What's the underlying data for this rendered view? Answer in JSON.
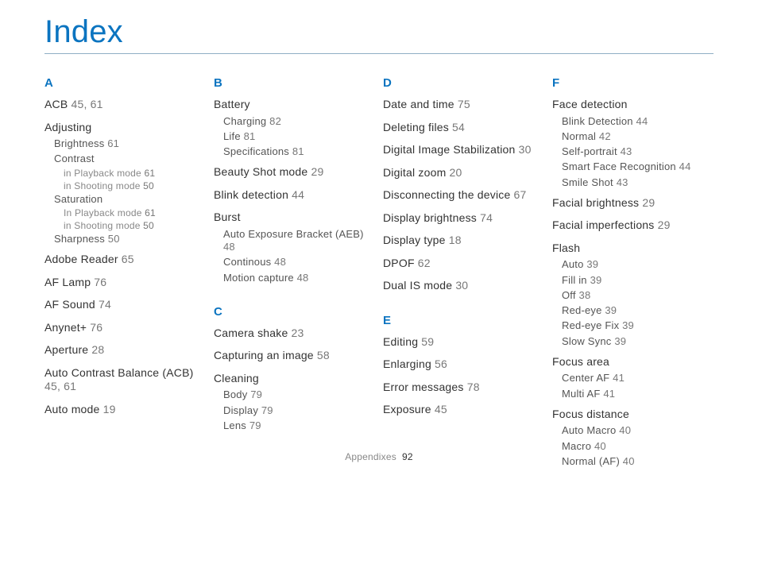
{
  "title": "Index",
  "footer": {
    "section": "Appendixes",
    "page": "92"
  },
  "columns": [
    [
      {
        "letter": "A",
        "items": [
          {
            "t": "ACB",
            "p": "45, 61"
          },
          {
            "t": "Adjusting",
            "children": [
              {
                "t": "Brightness",
                "p": "61"
              },
              {
                "t": "Contrast",
                "children": [
                  {
                    "t": "in Playback mode",
                    "p": "61"
                  },
                  {
                    "t": "in Shooting mode",
                    "p": "50"
                  }
                ]
              },
              {
                "t": "Saturation",
                "children": [
                  {
                    "t": "In Playback mode",
                    "p": "61"
                  },
                  {
                    "t": "in Shooting mode",
                    "p": "50"
                  }
                ]
              },
              {
                "t": "Sharpness",
                "p": "50"
              }
            ]
          },
          {
            "t": "Adobe Reader",
            "p": "65"
          },
          {
            "t": "AF Lamp",
            "p": "76"
          },
          {
            "t": "AF Sound",
            "p": "74"
          },
          {
            "t": "Anynet+",
            "p": "76"
          },
          {
            "t": "Aperture",
            "p": "28"
          },
          {
            "t": "Auto Contrast Balance (ACB)",
            "p": "45, 61"
          },
          {
            "t": "Auto mode",
            "p": "19"
          }
        ]
      }
    ],
    [
      {
        "letter": "B",
        "items": [
          {
            "t": "Battery",
            "children": [
              {
                "t": "Charging",
                "p": "82"
              },
              {
                "t": "Life",
                "p": "81"
              },
              {
                "t": "Specifications",
                "p": "81"
              }
            ]
          },
          {
            "t": "Beauty Shot mode",
            "p": "29"
          },
          {
            "t": "Blink detection",
            "p": "44"
          },
          {
            "t": "Burst",
            "children": [
              {
                "t": "Auto Exposure Bracket (AEB)",
                "p": "48"
              },
              {
                "t": "Continous",
                "p": "48"
              },
              {
                "t": "Motion capture",
                "p": "48"
              }
            ]
          }
        ]
      },
      {
        "letter": "C",
        "items": [
          {
            "t": "Camera shake",
            "p": "23"
          },
          {
            "t": "Capturing an image",
            "p": "58"
          },
          {
            "t": "Cleaning",
            "children": [
              {
                "t": "Body",
                "p": "79"
              },
              {
                "t": "Display",
                "p": "79"
              },
              {
                "t": "Lens",
                "p": "79"
              }
            ]
          }
        ]
      }
    ],
    [
      {
        "letter": "D",
        "items": [
          {
            "t": "Date and time",
            "p": "75"
          },
          {
            "t": "Deleting files",
            "p": "54"
          },
          {
            "t": "Digital Image Stabilization",
            "p": "30"
          },
          {
            "t": "Digital zoom",
            "p": "20"
          },
          {
            "t": "Disconnecting the device",
            "p": "67"
          },
          {
            "t": "Display brightness",
            "p": "74"
          },
          {
            "t": "Display type",
            "p": "18"
          },
          {
            "t": "DPOF",
            "p": "62"
          },
          {
            "t": "Dual IS mode",
            "p": "30"
          }
        ]
      },
      {
        "letter": "E",
        "items": [
          {
            "t": "Editing",
            "p": "59"
          },
          {
            "t": "Enlarging",
            "p": "56"
          },
          {
            "t": "Error messages",
            "p": "78"
          },
          {
            "t": "Exposure",
            "p": "45"
          }
        ]
      }
    ],
    [
      {
        "letter": "F",
        "items": [
          {
            "t": "Face detection",
            "children": [
              {
                "t": "Blink Detection",
                "p": "44"
              },
              {
                "t": "Normal",
                "p": "42"
              },
              {
                "t": "Self-portrait",
                "p": "43"
              },
              {
                "t": "Smart Face Recognition",
                "p": "44"
              },
              {
                "t": "Smile Shot",
                "p": "43"
              }
            ]
          },
          {
            "t": "Facial brightness",
            "p": "29"
          },
          {
            "t": "Facial imperfections",
            "p": "29"
          },
          {
            "t": "Flash",
            "children": [
              {
                "t": "Auto",
                "p": "39"
              },
              {
                "t": "Fill in",
                "p": "39"
              },
              {
                "t": "Off",
                "p": "38"
              },
              {
                "t": "Red-eye",
                "p": "39"
              },
              {
                "t": "Red-eye Fix",
                "p": "39"
              },
              {
                "t": "Slow Sync",
                "p": "39"
              }
            ]
          },
          {
            "t": "Focus area",
            "children": [
              {
                "t": "Center AF",
                "p": "41"
              },
              {
                "t": "Multi AF",
                "p": "41"
              }
            ]
          },
          {
            "t": "Focus distance",
            "children": [
              {
                "t": "Auto Macro",
                "p": "40"
              },
              {
                "t": "Macro",
                "p": "40"
              },
              {
                "t": "Normal (AF)",
                "p": "40"
              }
            ]
          }
        ]
      }
    ]
  ]
}
